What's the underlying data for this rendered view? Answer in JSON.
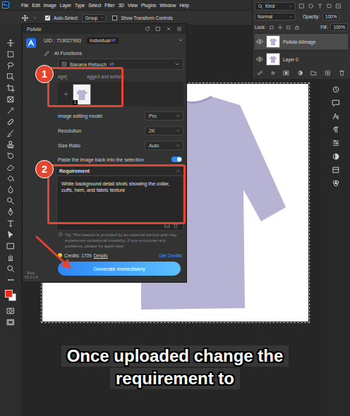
{
  "app": {
    "logo": "Ps"
  },
  "menu": [
    "File",
    "Edit",
    "Image",
    "Layer",
    "Type",
    "Select",
    "Filter",
    "3D",
    "View",
    "Plugins",
    "Window",
    "Help"
  ],
  "options_bar": {
    "auto_select": {
      "label": "Auto-Select:",
      "checked": true
    },
    "target": "Group",
    "transform": {
      "label": "Show Transform Controls",
      "checked": false
    }
  },
  "layers_panel": {
    "filter": "Kind",
    "blend_mode": "Normal",
    "opacity_label": "Opacity:",
    "opacity": "100%",
    "lock_label": "Lock:",
    "fill_label": "Fill:",
    "fill": "100%",
    "layers": [
      {
        "name": "PsAide AIImage",
        "selected": true,
        "visible": true
      },
      {
        "name": "Layer 0",
        "selected": false,
        "visible": true
      }
    ],
    "fx": "fx"
  },
  "plugin": {
    "title": "PsAide",
    "uid": "UID : 719027993",
    "plan": "Individual",
    "plan_badge": "V3",
    "functions_label": "AI Functions",
    "function": "Banana Retouch",
    "function_badge": "V3",
    "image_label": [
      "age(",
      "agged and sorted)"
    ],
    "upload_plus": "+",
    "thumbnail_count": "1",
    "fields": [
      {
        "label": "Image editing model",
        "value": "Pro"
      },
      {
        "label": "Resolution",
        "value": "2K"
      },
      {
        "label": "Size Ratio",
        "value": "Auto"
      }
    ],
    "paste": {
      "label": "Paste the image back into the selection",
      "on": true
    },
    "requirement_label": "Requirement",
    "requirement_text": "White background detail shots showing the collar, cuffs, hem, and fabric texture",
    "tip": "Tip: This feature is provided by an external service and may experience occasional instability. If you encounter any problems, please try again later",
    "credits": "Credits: 1709",
    "details": "Details",
    "get_credits": "Get Credits",
    "generate": "Generate immediately",
    "version": [
      "Beta",
      "V2.0.1.8"
    ]
  },
  "annotations": [
    "1",
    "2"
  ],
  "caption": [
    "Once uploaded change the",
    "requirement to"
  ]
}
